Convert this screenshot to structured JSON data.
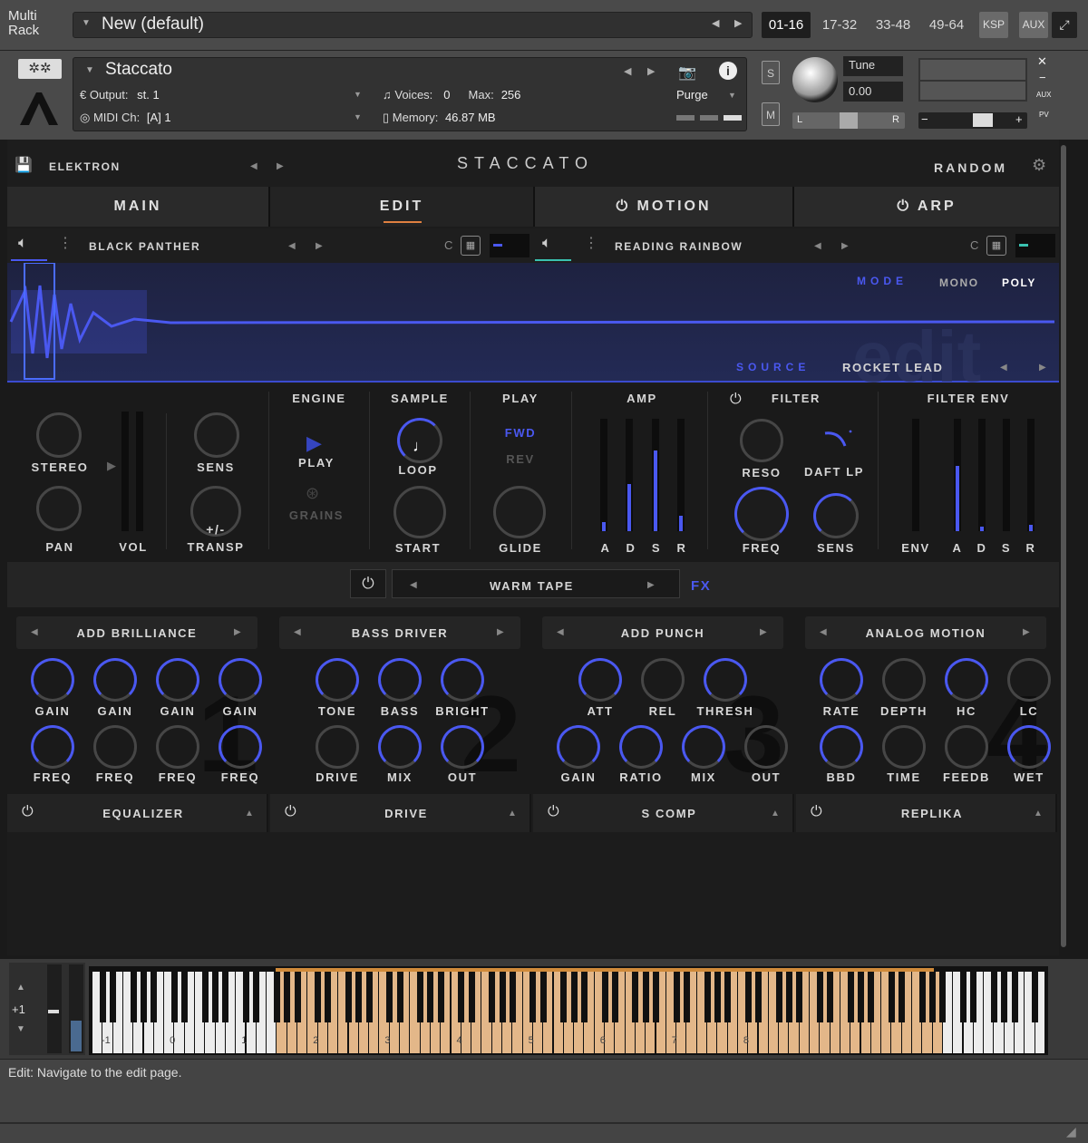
{
  "rack": {
    "label_line1": "Multi",
    "label_line2": "Rack",
    "preset": "New (default)",
    "tabs": [
      "01-16",
      "17-32",
      "33-48",
      "49-64"
    ],
    "ksp": "KSP",
    "aux": "AUX"
  },
  "instrument": {
    "name": "Staccato",
    "output_label": "Output:",
    "output": "st. 1",
    "midi_label": "MIDI Ch:",
    "midi": "[A]  1",
    "voices_label": "Voices:",
    "voices": "0",
    "max_label": "Max:",
    "max": "256",
    "memory_label": "Memory:",
    "memory": "46.87 MB",
    "purge": "Purge",
    "s": "S",
    "m": "M",
    "tune_label": "Tune",
    "tune": "0.00",
    "l": "L",
    "r": "R",
    "aux": "AUX",
    "pv": "PV"
  },
  "plugin": {
    "bank": "ELEKTRON",
    "title": "STACCATO",
    "random": "RANDOM",
    "tabs": [
      "MAIN",
      "EDIT",
      "MOTION",
      "ARP"
    ],
    "layer_a": "BLACK PANTHER",
    "layer_b": "READING RAINBOW",
    "c_a": "C",
    "c_b": "C",
    "mode_label": "MODE",
    "mono": "MONO",
    "poly": "POLY",
    "source_label": "SOURCE",
    "source": "ROCKET LEAD",
    "watermark": "edit",
    "left": {
      "stereo": "STEREO",
      "pan": "PAN",
      "vol": "VOL",
      "sens": "SENS",
      "transp": "TRANSP",
      "transp_sym": "+/-"
    },
    "engine": {
      "title": "ENGINE",
      "play": "PLAY",
      "grains": "GRAINS"
    },
    "sample": {
      "title": "SAMPLE",
      "loop": "LOOP",
      "start": "START"
    },
    "play": {
      "title": "PLAY",
      "fwd": "FWD",
      "rev": "REV",
      "glide": "GLIDE"
    },
    "amp": {
      "title": "AMP",
      "a": "A",
      "d": "D",
      "s": "S",
      "r": "R",
      "values": [
        0.08,
        0.42,
        0.72,
        0.14
      ]
    },
    "filter": {
      "title": "FILTER",
      "reso": "RESO",
      "type": "DAFT LP",
      "freq": "FREQ",
      "sens": "SENS"
    },
    "fenv": {
      "title": "FILTER ENV",
      "env": "ENV",
      "a": "A",
      "d": "D",
      "s": "S",
      "r": "R",
      "values": [
        0,
        0.58,
        0.04,
        0,
        0.06
      ]
    },
    "fx": {
      "preset": "WARM TAPE",
      "label": "FX"
    },
    "slots": [
      {
        "name": "ADD BRILLIANCE",
        "num": "1",
        "row1": [
          "GAIN",
          "GAIN",
          "GAIN",
          "GAIN"
        ],
        "row2": [
          "FREQ",
          "FREQ",
          "FREQ",
          "FREQ"
        ],
        "footer": "EQUALIZER"
      },
      {
        "name": "BASS DRIVER",
        "num": "2",
        "row1": [
          "TONE",
          "BASS",
          "BRIGHT"
        ],
        "row2": [
          "DRIVE",
          "MIX",
          "OUT"
        ],
        "footer": "DRIVE"
      },
      {
        "name": "ADD PUNCH",
        "num": "3",
        "row1": [
          "ATT",
          "REL",
          "THRESH"
        ],
        "row2": [
          "GAIN",
          "RATIO",
          "MIX",
          "OUT"
        ],
        "footer": "S COMP"
      },
      {
        "name": "ANALOG MOTION",
        "num": "4",
        "row1": [
          "RATE",
          "DEPTH",
          "HC",
          "LC"
        ],
        "row2": [
          "BBD",
          "TIME",
          "FEEDB",
          "WET"
        ],
        "footer": "REPLIKA"
      }
    ]
  },
  "keyboard": {
    "octave": "+1",
    "labels": [
      "-1",
      "0",
      "1",
      "2",
      "3",
      "4",
      "5",
      "6",
      "7",
      "8"
    ]
  },
  "status": "Edit: Navigate to the edit page.",
  "colors": {
    "accent": "#4a58f0",
    "key_range": "#e3b789"
  }
}
